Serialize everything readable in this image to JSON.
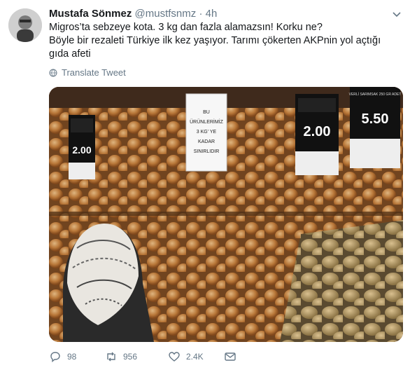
{
  "tweet": {
    "author_name": "Mustafa Sönmez",
    "author_handle": "@mustfsnmz",
    "separator": "·",
    "time": "4h",
    "text_line1": "Migros’ta sebzeye kota. 3 kg dan fazla alamazsın! Korku ne?",
    "text_line2": "Böyle bir rezaleti Türkiye ilk kez yaşıyor. Tarımı çökerten AKPnin yol açtığı gıda afeti",
    "translate_label": "Translate Tweet"
  },
  "photo": {
    "sign_line1": "BU",
    "sign_line2": "ÜRÜNLERİMİZ",
    "sign_line3": "3 KG' YE",
    "sign_line4": "KADAR",
    "sign_line5": "SINIRLIDIR",
    "price_left": "2.00",
    "price_mid": "2.00",
    "price_right": "5.50",
    "price_right_label": "VERLİ SARIMSAK 250 GR ADET"
  },
  "actions": {
    "replies": "98",
    "retweets": "956",
    "likes": "2.4K"
  }
}
